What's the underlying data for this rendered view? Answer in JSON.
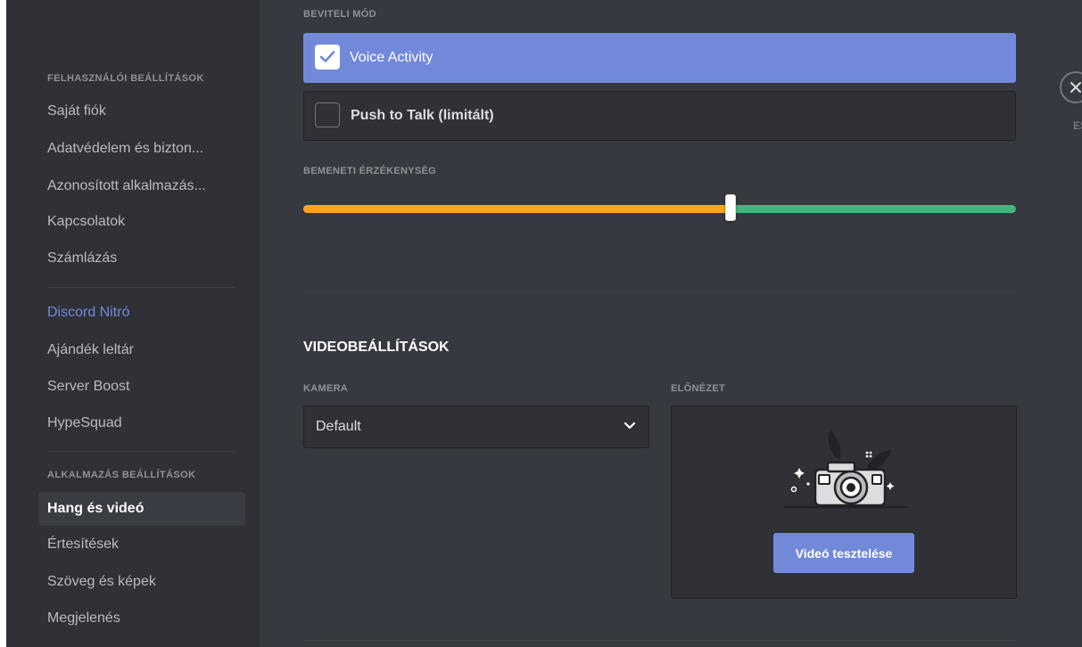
{
  "sidebar": {
    "user_settings_header": "FELHASZNÁLÓI BEÁLLÍTÁSOK",
    "user_items": [
      {
        "label": "Saját fiók"
      },
      {
        "label": "Adatvédelem és bizton..."
      },
      {
        "label": "Azonosított alkalmazás..."
      },
      {
        "label": "Kapcsolatok"
      },
      {
        "label": "Számlázás"
      }
    ],
    "nitro_items": [
      {
        "label": "Discord Nitró"
      },
      {
        "label": "Ajándék leltár"
      },
      {
        "label": "Server Boost"
      },
      {
        "label": "HypeSquad"
      }
    ],
    "app_settings_header": "ALKALMAZÁS BEÁLLÍTÁSOK",
    "app_items": [
      {
        "label": "Hang és videó",
        "selected": true
      },
      {
        "label": "Értesítések"
      },
      {
        "label": "Szöveg és képek"
      },
      {
        "label": "Megjelenés"
      }
    ]
  },
  "voice": {
    "input_mode_label": "BEVITELI MÓD",
    "options": [
      {
        "label": "Voice Activity",
        "checked": true
      },
      {
        "label": "Push to Talk (limitált)",
        "checked": false
      }
    ],
    "sensitivity_label": "BEMENETI ÉRZÉKENYSÉG",
    "sensitivity_level": 0.6
  },
  "video": {
    "title": "VIDEOBEÁLLÍTÁSOK",
    "camera_label": "KAMERA",
    "camera_value": "Default",
    "preview_label": "ELŐNÉZET",
    "test_button": "Videó tesztelése"
  },
  "close": {
    "label": "ES"
  },
  "colors": {
    "accent": "#7289da",
    "slider_low": "#faa61a",
    "slider_high": "#43b581",
    "background": "#36393f",
    "sidebar": "#2f3136"
  },
  "icons": [
    "check-icon",
    "chevron-down-icon",
    "close-icon",
    "camera-illustration"
  ]
}
